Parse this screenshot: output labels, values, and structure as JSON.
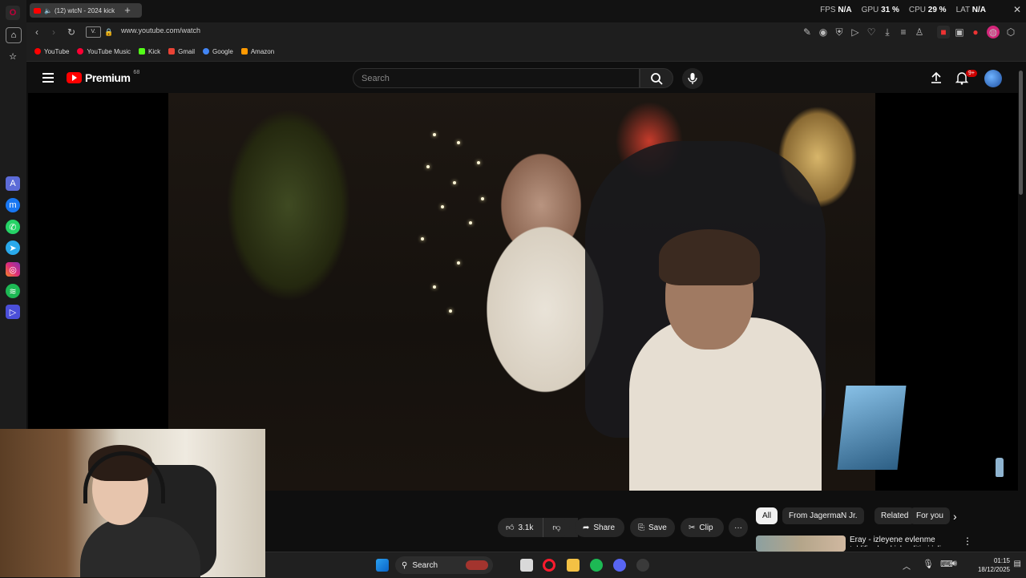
{
  "browser": {
    "tab_title": "(12) wtcN - 2024 kick",
    "url": "www.youtube.com/watch",
    "view_badge": "V.",
    "perf": {
      "fps_label": "FPS",
      "fps_value": "N/A",
      "gpu_label": "GPU",
      "gpu_value": "31 %",
      "cpu_label": "CPU",
      "cpu_value": "29 %",
      "lat_label": "LAT",
      "lat_value": "N/A"
    },
    "bookmarks": [
      {
        "label": "YouTube",
        "color": "#ff0000"
      },
      {
        "label": "YouTube Music",
        "color": "#ff0033"
      },
      {
        "label": "Kick",
        "color": "#53fc18"
      },
      {
        "label": "Gmail",
        "color": "#ea4335"
      },
      {
        "label": "Google",
        "color": "#4285f4"
      },
      {
        "label": "Amazon",
        "color": "#ff9900"
      }
    ],
    "sidebar_apps": [
      "aria-icon",
      "messenger-icon",
      "whatsapp-icon",
      "telegram-icon",
      "instagram-icon",
      "spotify-icon",
      "player-icon"
    ]
  },
  "youtube": {
    "logo_text": "Premium",
    "logo_sup": "68",
    "search_placeholder": "Search",
    "notification_count": "9+",
    "likes": "3.1k",
    "share_label": "Share",
    "save_label": "Save",
    "clip_label": "Clip",
    "more_label": "···",
    "chips": [
      "All",
      "From JagermaN Jr.",
      "Related",
      "For you"
    ],
    "recommendation_title": "Eray - izleyene evlenme teklifi eden kick editimi izliyor"
  },
  "taskbar": {
    "search_label": "Search",
    "time": "01:15",
    "date": "18/12/2025"
  },
  "colors": {
    "accent_red": "#ff0000",
    "bg": "#0f0f0f"
  }
}
